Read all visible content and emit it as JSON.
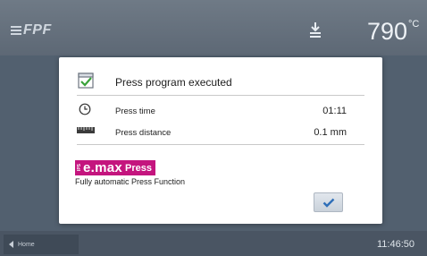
{
  "header": {
    "logo_text": "FPF",
    "temperature_value": "790",
    "temperature_unit": "°C"
  },
  "dialog": {
    "title": "Press program executed",
    "rows": [
      {
        "label": "Press time",
        "value": "01:11"
      },
      {
        "label": "Press distance",
        "value": "0.1 mm"
      }
    ],
    "brand": {
      "name": "e.max",
      "suffix": "Press",
      "prefix_small": "IPS"
    },
    "description": "Fully automatic Press Function"
  },
  "footer": {
    "home_label": "Home",
    "time": "11:46:50"
  },
  "colors": {
    "brand": "#c4157e",
    "check": "#2f6fb8",
    "doc_check": "#3aa23a"
  }
}
